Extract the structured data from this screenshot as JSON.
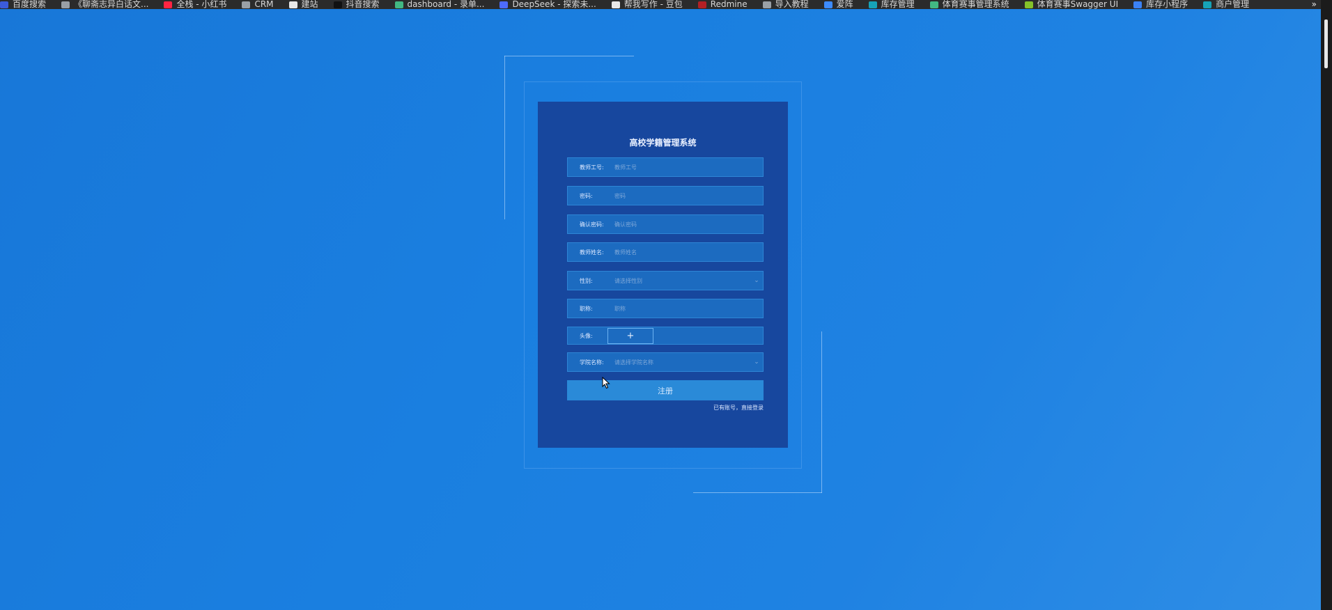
{
  "bookmarks": [
    {
      "label": "百度搜索",
      "icon": "bookmark-app-icon",
      "color": "#3b5bdb"
    },
    {
      "label": "《聊斋志异白话文...",
      "icon": "globe-icon",
      "color": "#9aa0a6"
    },
    {
      "label": "全栈 - 小红书",
      "icon": "xiaohongshu-icon",
      "color": "#ff2442"
    },
    {
      "label": "CRM",
      "icon": "globe-icon",
      "color": "#9aa0a6"
    },
    {
      "label": "建站",
      "icon": "bookmark-app-icon",
      "color": "#e8e8e8"
    },
    {
      "label": "抖音搜索",
      "icon": "douyin-icon",
      "color": "#111111"
    },
    {
      "label": "dashboard - 录单...",
      "icon": "vue-icon",
      "color": "#42b883"
    },
    {
      "label": "DeepSeek - 探索未...",
      "icon": "deepseek-icon",
      "color": "#4d6bfe"
    },
    {
      "label": "帮我写作 - 豆包",
      "icon": "doubao-icon",
      "color": "#e8e8e8"
    },
    {
      "label": "Redmine",
      "icon": "redmine-icon",
      "color": "#b32024"
    },
    {
      "label": "导入教程",
      "icon": "globe-icon",
      "color": "#9aa0a6"
    },
    {
      "label": "爱阵",
      "icon": "shield-icon",
      "color": "#3d8bfd"
    },
    {
      "label": "库存管理",
      "icon": "app-icon",
      "color": "#16a3b8"
    },
    {
      "label": "体育赛事管理系统",
      "icon": "vue-icon",
      "color": "#42b883"
    },
    {
      "label": "体育赛事Swagger UI",
      "icon": "swagger-icon",
      "color": "#85c22a"
    },
    {
      "label": "库存小程序",
      "icon": "mountain-icon",
      "color": "#3b82f6"
    },
    {
      "label": "商户管理",
      "icon": "app-icon",
      "color": "#16a3b8"
    }
  ],
  "bookmarks_more": "»",
  "form": {
    "title": "高校学籍管理系统",
    "teacher_id": {
      "label": "教师工号:",
      "placeholder": "教师工号"
    },
    "password": {
      "label": "密码:",
      "placeholder": "密码"
    },
    "confirm_password": {
      "label": "确认密码:",
      "placeholder": "确认密码"
    },
    "teacher_name": {
      "label": "教师姓名:",
      "placeholder": "教师姓名"
    },
    "gender": {
      "label": "性别:",
      "placeholder": "请选择性别"
    },
    "title_field": {
      "label": "职称:",
      "placeholder": "职称"
    },
    "avatar": {
      "label": "头像:",
      "upload_symbol": "+"
    },
    "college": {
      "label": "学院名称:",
      "placeholder": "请选择学院名称"
    },
    "submit_label": "注册",
    "login_link": "已有账号，直接登录"
  },
  "colors": {
    "background": "#1a7fe0",
    "card": "#17479e",
    "field": "#1c6bc0",
    "button": "#2a8ad8"
  }
}
